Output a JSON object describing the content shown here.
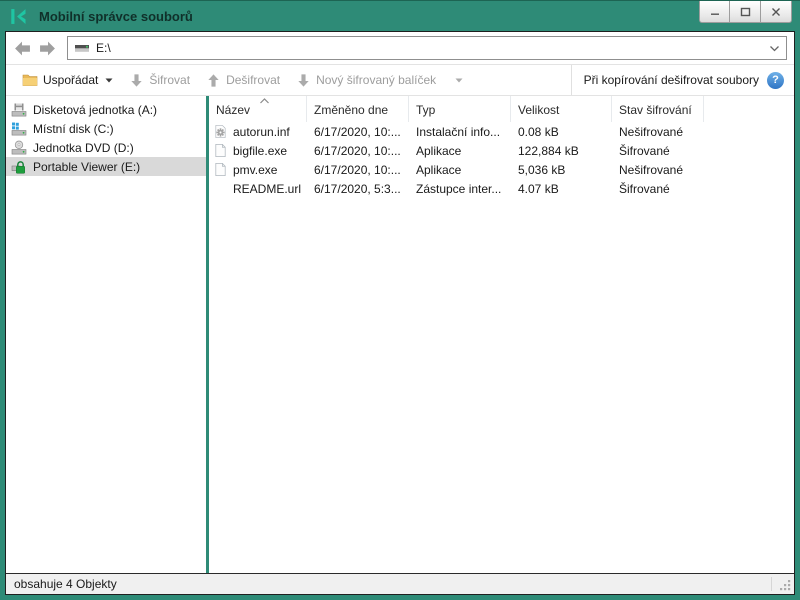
{
  "window": {
    "title": "Mobilní správce souborů",
    "accent_color": "#2E8B77",
    "logo_color": "#1FC5A3"
  },
  "navbar": {
    "address": "E:\\",
    "icons": [
      "back-icon",
      "forward-icon",
      "drive-icon",
      "chevron-down-icon"
    ]
  },
  "toolbar": {
    "organize_label": "Uspořádat",
    "encrypt_label": "Šifrovat",
    "decrypt_label": "Dešifrovat",
    "new_package_label": "Nový šifrovaný balíček",
    "decrypt_on_copy_label": "Při kopírování dešifrovat soubory",
    "help_glyph": "?"
  },
  "sidebar": {
    "items": [
      {
        "label": "Disketová jednotka (A:)",
        "icon": "floppy-drive-icon",
        "selected": false
      },
      {
        "label": "Místní disk (C:)",
        "icon": "local-disk-icon",
        "selected": false
      },
      {
        "label": "Jednotka DVD (D:)",
        "icon": "dvd-drive-icon",
        "selected": false
      },
      {
        "label": "Portable Viewer (E:)",
        "icon": "locked-drive-icon",
        "selected": true
      }
    ],
    "selected_bg": "#D9D9D9"
  },
  "file_list": {
    "columns": [
      "Název",
      "Změněno dne",
      "Typ",
      "Velikost",
      "Stav šifrování"
    ],
    "sort_column": "Název",
    "sort_direction": "ascending",
    "rows": [
      {
        "name": "autorun.inf",
        "modified": "6/17/2020, 10:...",
        "type": "Instalační info...",
        "size": "0.08 kB",
        "encryption": "Nešifrované",
        "icon": "gear-file-icon"
      },
      {
        "name": "bigfile.exe",
        "modified": "6/17/2020, 10:...",
        "type": "Aplikace",
        "size": "122,884 kB",
        "encryption": "Šifrované",
        "icon": "file-icon"
      },
      {
        "name": "pmv.exe",
        "modified": "6/17/2020, 10:...",
        "type": "Aplikace",
        "size": "5,036 kB",
        "encryption": "Nešifrované",
        "icon": "file-icon"
      },
      {
        "name": "README.url",
        "modified": "6/17/2020, 5:3...",
        "type": "Zástupce inter...",
        "size": "4.07 kB",
        "encryption": "Šifrované",
        "icon": "none"
      }
    ]
  },
  "statusbar": {
    "text": "obsahuje 4 Objekty"
  }
}
